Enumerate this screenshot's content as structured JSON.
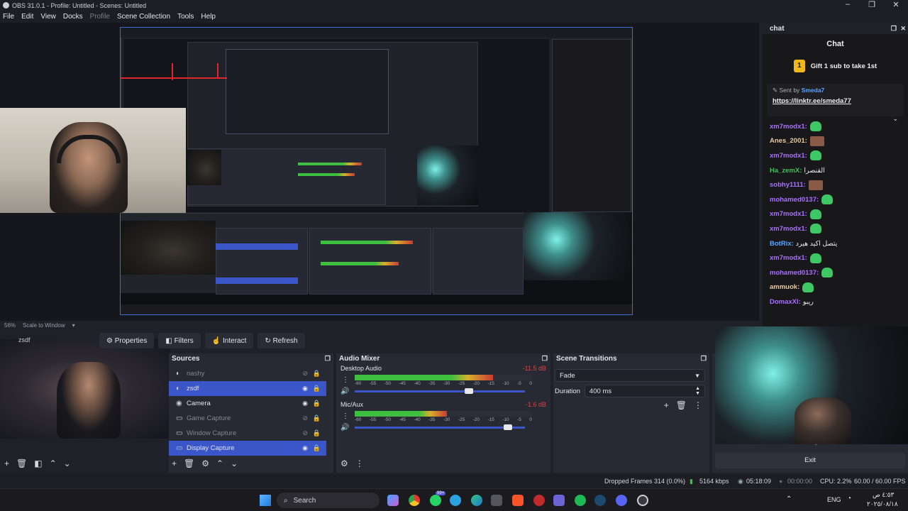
{
  "window": {
    "title": "OBS 31.0.1 - Profile: Untitled - Scenes: Untitled"
  },
  "menu": [
    "File",
    "Edit",
    "View",
    "Docks",
    "Profile",
    "Scene Collection",
    "Tools",
    "Help"
  ],
  "preview": {
    "zoom": "56%",
    "scale_mode": "Scale to Window"
  },
  "chat": {
    "dock_title": "chat",
    "title": "Chat",
    "gift": "Gift 1 sub to take 1st",
    "pinned": {
      "sent_by_label": "Sent by",
      "sender": "Smeda7",
      "link": "https://linktr.ee/smeda77"
    },
    "messages": [
      {
        "user": "xm7modx1:",
        "color": "#a970ff",
        "text": ""
      },
      {
        "user": "Anes_2001:",
        "color": "#e8c9a0",
        "text": ""
      },
      {
        "user": "xm7modx1:",
        "color": "#a970ff",
        "text": ""
      },
      {
        "user": "Ha_zemX:",
        "color": "#3fbf5a",
        "text": "القنصرا"
      },
      {
        "user": "sobhy1111:",
        "color": "#a970ff",
        "text": ""
      },
      {
        "user": "mohamed0137:",
        "color": "#a970ff",
        "text": ""
      },
      {
        "user": "xm7modx1:",
        "color": "#a970ff",
        "text": ""
      },
      {
        "user": "xm7modx1:",
        "color": "#a970ff",
        "text": ""
      },
      {
        "user": "BotRix:",
        "color": "#58a6ff",
        "text": "يتصل اكيد هيرد"
      },
      {
        "user": "xm7modx1:",
        "color": "#a970ff",
        "text": ""
      },
      {
        "user": "mohamed0137:",
        "color": "#a970ff",
        "text": ""
      },
      {
        "user": "ammuok:",
        "color": "#e8c9a0",
        "text": ""
      },
      {
        "user": "DomaxXl:",
        "color": "#a970ff",
        "text": "ريبو"
      }
    ]
  },
  "toolbar": {
    "current_source": "zsdf",
    "properties": "Properties",
    "filters": "Filters",
    "interact": "Interact",
    "refresh": "Refresh"
  },
  "sources": {
    "title": "Sources",
    "items": [
      {
        "name": "nashy",
        "visible": false
      },
      {
        "name": "zsdf",
        "visible": true,
        "selected": true
      },
      {
        "name": "Camera",
        "visible": true
      },
      {
        "name": "Game Capture",
        "visible": false
      },
      {
        "name": "Window Capture",
        "visible": false
      },
      {
        "name": "Display Capture",
        "visible": true,
        "selected": true
      }
    ]
  },
  "mixer": {
    "title": "Audio Mixer",
    "channels": [
      {
        "name": "Desktop Audio",
        "db": "-11.5 dB",
        "level": 0.78,
        "volume": 0.68
      },
      {
        "name": "Mic/Aux",
        "db": "-1.6 dB",
        "level": 0.52,
        "volume": 0.92
      }
    ],
    "ticks": [
      "-60",
      "-55",
      "-50",
      "-45",
      "-40",
      "-35",
      "-30",
      "-25",
      "-20",
      "-15",
      "-10",
      "-5",
      "0"
    ]
  },
  "transitions": {
    "title": "Scene Transitions",
    "transition": "Fade",
    "duration_label": "Duration",
    "duration": "400 ms"
  },
  "controls": {
    "settings": "Settings",
    "exit": "Exit"
  },
  "status": {
    "dropped": "Dropped Frames 314 (0.0%)",
    "bitrate": "5164 kbps",
    "live_time": "05:18:09",
    "rec_time": "00:00:00",
    "cpu": "CPU: 2.2%",
    "fps": "60.00 / 60.00 FPS"
  },
  "taskbar": {
    "search": "Search",
    "lang": "ENG",
    "time": "٤:٥٣ ص",
    "date": "٢٠٢٥/٠٨/١٨",
    "badge": "99+"
  }
}
